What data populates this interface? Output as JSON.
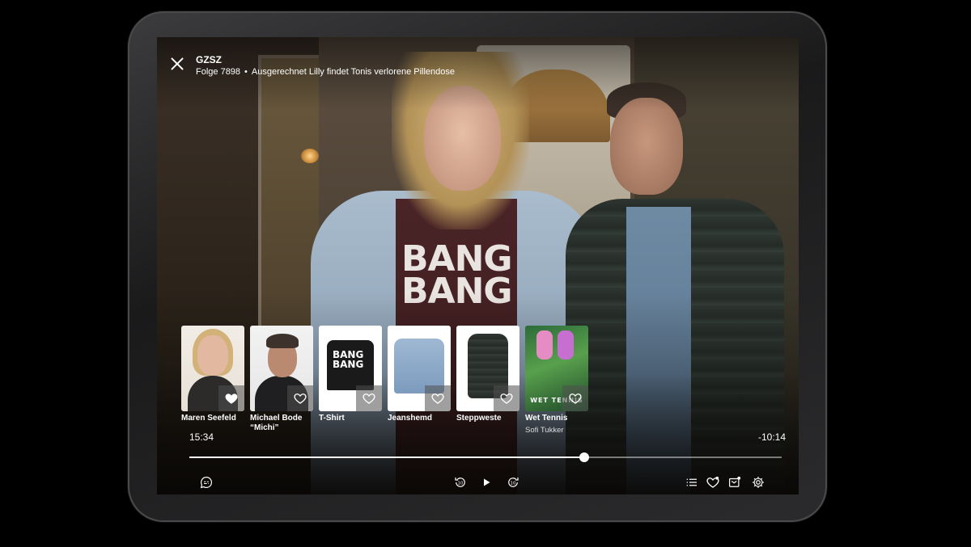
{
  "header": {
    "show_title": "GZSZ",
    "episode_number": "Folge 7898",
    "separator": "•",
    "episode_title": "Ausgerechnet Lilly findet Tonis verlorene Pillendose"
  },
  "scene": {
    "shirt_text": "BANG BANG"
  },
  "carousel": {
    "items": [
      {
        "title": "Maren Seefeld",
        "subtitle": "",
        "favorited": true
      },
      {
        "title": "Michael Bode “Michi”",
        "subtitle": "",
        "favorited": false
      },
      {
        "title": "T-Shirt",
        "subtitle": "",
        "favorited": false,
        "thumb_text": "BANG BANG"
      },
      {
        "title": "Jeanshemd",
        "subtitle": "",
        "favorited": false
      },
      {
        "title": "Steppweste",
        "subtitle": "",
        "favorited": false
      },
      {
        "title": "Wet Tennis",
        "subtitle": "Sofi Tukker",
        "favorited": false,
        "thumb_text": "WET TENNIS"
      }
    ]
  },
  "player": {
    "elapsed": "15:34",
    "remaining": "-10:14",
    "progress": 0.667
  },
  "controls": {
    "left": [
      "subtitles-icon"
    ],
    "center": [
      "rewind-10-icon",
      "play-icon",
      "forward-10-icon"
    ],
    "right": [
      "episode-list-icon",
      "favorites-icon",
      "watchlist-icon",
      "settings-icon"
    ],
    "rewind_label": "10",
    "forward_label": "10"
  },
  "colors": {
    "background": "#000000",
    "overlay_text": "#ffffff",
    "track": "#ffffff"
  }
}
